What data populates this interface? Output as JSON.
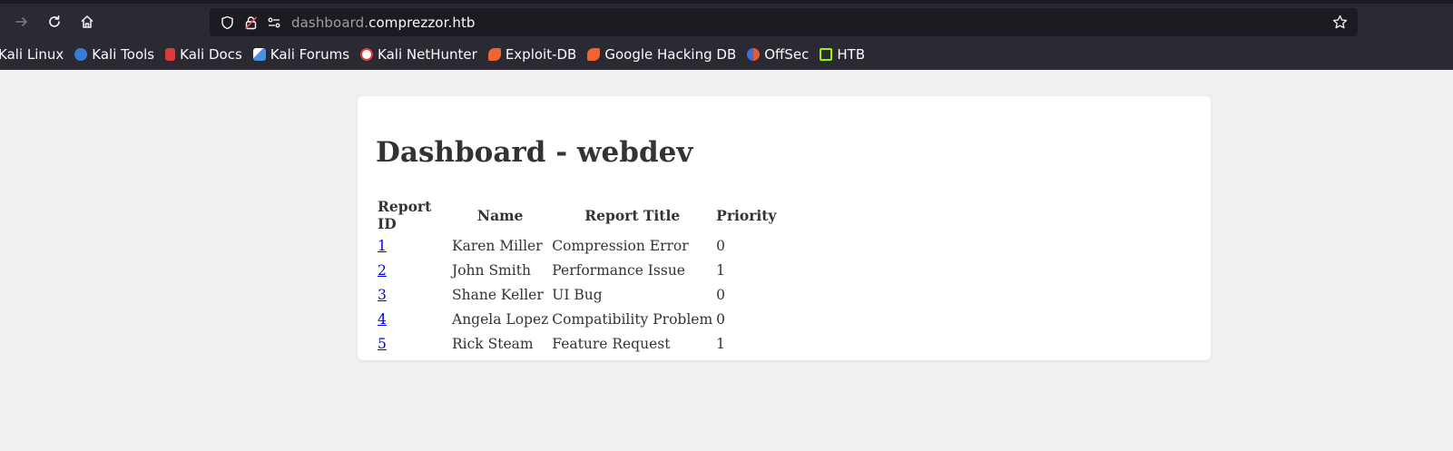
{
  "browser": {
    "url_subdomain": "dashboard.",
    "url_domain": "comprezzor.htb",
    "bookmarks": [
      {
        "label": "Kali Linux",
        "icon": "kali-linux-icon",
        "color": ""
      },
      {
        "label": "Kali Tools",
        "icon": "kali-tools-icon",
        "color": "#3a7bd5"
      },
      {
        "label": "Kali Docs",
        "icon": "kali-docs-icon",
        "color": "#d93a3a"
      },
      {
        "label": "Kali Forums",
        "icon": "kali-forums-icon",
        "color": "#4a90e2"
      },
      {
        "label": "Kali NetHunter",
        "icon": "kali-nethunter-icon",
        "color": "#e23a3a"
      },
      {
        "label": "Exploit-DB",
        "icon": "exploit-db-icon",
        "color": "#f0652f"
      },
      {
        "label": "Google Hacking DB",
        "icon": "google-hacking-db-icon",
        "color": "#f0652f"
      },
      {
        "label": "OffSec",
        "icon": "offsec-icon",
        "color": "#3a6fe2"
      },
      {
        "label": "HTB",
        "icon": "htb-icon",
        "color": "#9fef00"
      }
    ]
  },
  "dashboard": {
    "title": "Dashboard - webdev",
    "columns": [
      "Report ID",
      "Name",
      "Report Title",
      "Priority"
    ],
    "rows": [
      {
        "id": "1",
        "name": "Karen Miller",
        "title": "Compression Error",
        "priority": "0"
      },
      {
        "id": "2",
        "name": "John Smith",
        "title": "Performance Issue",
        "priority": "1"
      },
      {
        "id": "3",
        "name": "Shane Keller",
        "title": "UI Bug",
        "priority": "0"
      },
      {
        "id": "4",
        "name": "Angela Lopez",
        "title": "Compatibility Problem",
        "priority": "0"
      },
      {
        "id": "5",
        "name": "Rick Steam",
        "title": "Feature Request",
        "priority": "1"
      }
    ]
  }
}
